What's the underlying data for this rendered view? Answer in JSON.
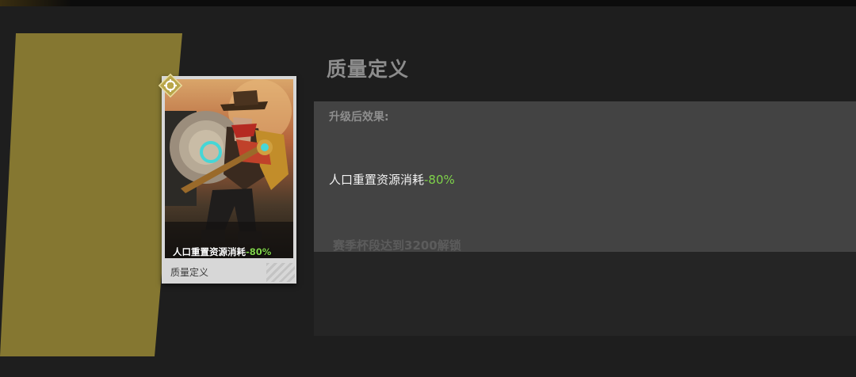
{
  "card": {
    "effect_text": "人口重置资源消耗",
    "effect_value": "-80%",
    "name": "质量定义",
    "badge_icon": "gear-badge-icon",
    "accent_color": "#7fd34a"
  },
  "detail": {
    "title": "质量定义",
    "upgrade_heading": "升级后效果:",
    "effect_text": "人口重置资源消耗",
    "effect_value": "-80%",
    "unlock_condition": "赛季杯段达到3200解锁"
  },
  "colors": {
    "banner": "#857731",
    "panel": "#434343",
    "background": "#1e1e1e",
    "highlight": "#7fd34a"
  }
}
